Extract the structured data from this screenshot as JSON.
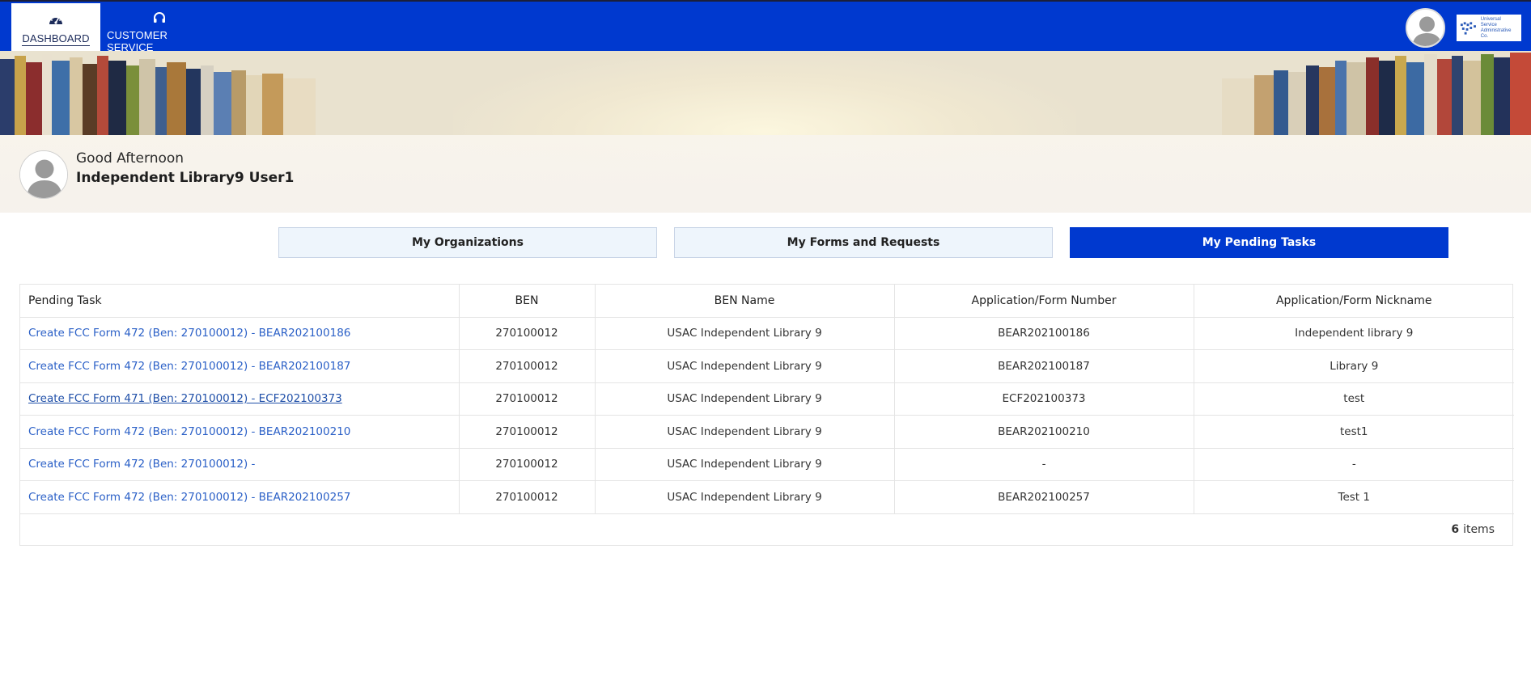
{
  "nav": {
    "tabs": [
      {
        "label": "DASHBOARD",
        "icon": "dashboard-gauge-icon",
        "active": true
      },
      {
        "label": "CUSTOMER SERVICE",
        "icon": "headset-icon",
        "active": false
      }
    ],
    "logo_text": [
      "Universal Service",
      "Administrative Co."
    ],
    "bar_color": "#0039cf"
  },
  "greeting": {
    "salutation": "Good Afternoon",
    "user_name": "Independent Library9 User1"
  },
  "section_tabs": [
    {
      "label": "My Organizations",
      "active": false
    },
    {
      "label": "My Forms and Requests",
      "active": false
    },
    {
      "label": "My Pending Tasks",
      "active": true
    }
  ],
  "table": {
    "headers": [
      "Pending Task",
      "BEN",
      "BEN Name",
      "Application/Form Number",
      "Application/Form Nickname"
    ],
    "rows": [
      {
        "task": "Create FCC Form 472 (Ben: 270100012) - BEAR202100186",
        "ben": "270100012",
        "ben_name": "USAC Independent Library 9",
        "form_number": "BEAR202100186",
        "nickname": "Independent library 9"
      },
      {
        "task": "Create FCC Form 472 (Ben: 270100012) - BEAR202100187",
        "ben": "270100012",
        "ben_name": "USAC Independent Library 9",
        "form_number": "BEAR202100187",
        "nickname": "Library 9"
      },
      {
        "task": "Create FCC Form 471 (Ben: 270100012) - ECF202100373",
        "ben": "270100012",
        "ben_name": "USAC Independent Library 9",
        "form_number": "ECF202100373",
        "nickname": "test"
      },
      {
        "task": "Create FCC Form 472 (Ben: 270100012) - BEAR202100210",
        "ben": "270100012",
        "ben_name": "USAC Independent Library 9",
        "form_number": "BEAR202100210",
        "nickname": "test1"
      },
      {
        "task": "Create FCC Form 472 (Ben: 270100012) -",
        "ben": "270100012",
        "ben_name": "USAC Independent Library 9",
        "form_number": "-",
        "nickname": "-"
      },
      {
        "task": "Create FCC Form 472 (Ben: 270100012) - BEAR202100257",
        "ben": "270100012",
        "ben_name": "USAC Independent Library 9",
        "form_number": "BEAR202100257",
        "nickname": "Test 1"
      }
    ],
    "footer_count": "6",
    "footer_label": "items"
  },
  "colors": {
    "primary": "#0039cf",
    "link": "#2b60c7",
    "tab_inactive_bg": "#eef5fc"
  }
}
